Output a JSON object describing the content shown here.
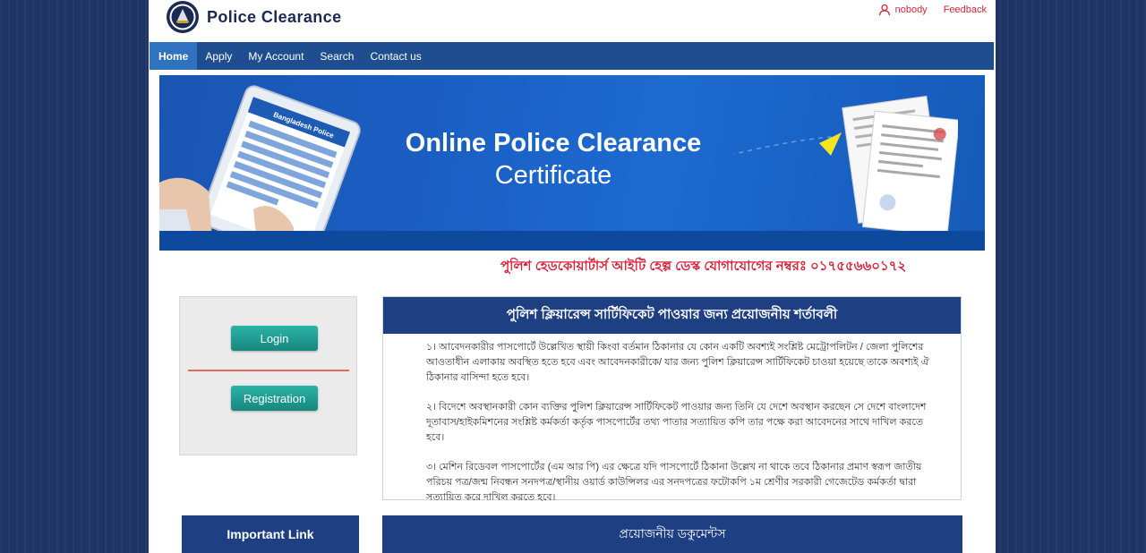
{
  "header": {
    "site_title": "Police Clearance",
    "user_name": "nobody",
    "feedback_label": "Feedback"
  },
  "nav": {
    "items": [
      {
        "label": "Home",
        "active": true
      },
      {
        "label": "Apply",
        "active": false
      },
      {
        "label": "My Account",
        "active": false
      },
      {
        "label": "Search",
        "active": false
      },
      {
        "label": "Contact us",
        "active": false
      }
    ]
  },
  "banner": {
    "title": "Online Police Clearance",
    "subtitle": "Certificate",
    "tablet_label": "Bangladesh Police"
  },
  "helpline": "পুলিশ হেডকোয়ার্টার্স আইটি হেল্প ডেস্ক যোগাযোগের নম্বরঃ ০১৭৫৫৬৬০১৭২",
  "auth": {
    "login_label": "Login",
    "registration_label": "Registration"
  },
  "conditions": {
    "title": "পুলিশ ক্লিয়ারেন্স সার্টিফিকেট পাওয়ার জন্য প্রয়োজনীয় শর্তাবলী",
    "items": [
      "১। আবেদনকারীর পাসপোর্টে উল্লেখিত স্থায়ী কিংবা বর্তমান ঠিকানার যে কোন একটি অবশ্যই সংশ্লিষ্ট মেট্রোপলিটন / জেলা পুলিশের আওতাধীন এলাকায় অবস্থিত হতে হবে এবং আবেদনকারীকে/ যার জন্য পুলিশ ক্লিয়ারেন্স সার্টিফিকেট চাওয়া হয়েছে তাকে অবশ্যই ঐ ঠিকানার বাসিন্দা হতে হবে।",
      "২। বিদেশে অবস্থানকারী কোন ব্যক্তির পুলিশ ক্লিয়ারেন্স সার্টিফিকেট পাওয়ার জন্য তিনি যে দেশে অবস্থান করছেন সে দেশে বাংলাদেশ দূতাবাস/হাইকমিশনের সংশ্লিষ্ট কর্মকর্তা কর্তৃক পাসপোর্টের তথ্য পাতার সত্যায়িত কপি তার পক্ষে করা আবেদনের সাথে দাখিল করতে হবে।",
      "৩। মেশিন রিডেবল পাসপোর্টের (এম আর পি) এর ক্ষেত্রে যদি পাসপোর্টে ঠিকানা উল্লেখ না থাকে তবে ঠিকানার প্রমাণ স্বরূপ জাতীয় পরিচয় পত্র/জন্ম নিবন্ধন সনদপত্র/স্থানীয় ওয়ার্ড কাউন্সিলর এর সনদপত্রের ফটোকপি ১ম শ্রেণীর সরকারী গেজেটেড কর্মকর্তা দ্বারা সত্যায়িত করে দাখিল করতে হবে।"
    ]
  },
  "important_link_title": "Important Link",
  "documents_title": "প্রয়োজনীয় ডকুমেন্টস",
  "colors": {
    "nav_bg": "#1e4e8f",
    "nav_active": "#2f73bf",
    "panel_header": "#1f3f83",
    "accent_red": "#d6253b",
    "button_teal": "#1a9a8f"
  }
}
